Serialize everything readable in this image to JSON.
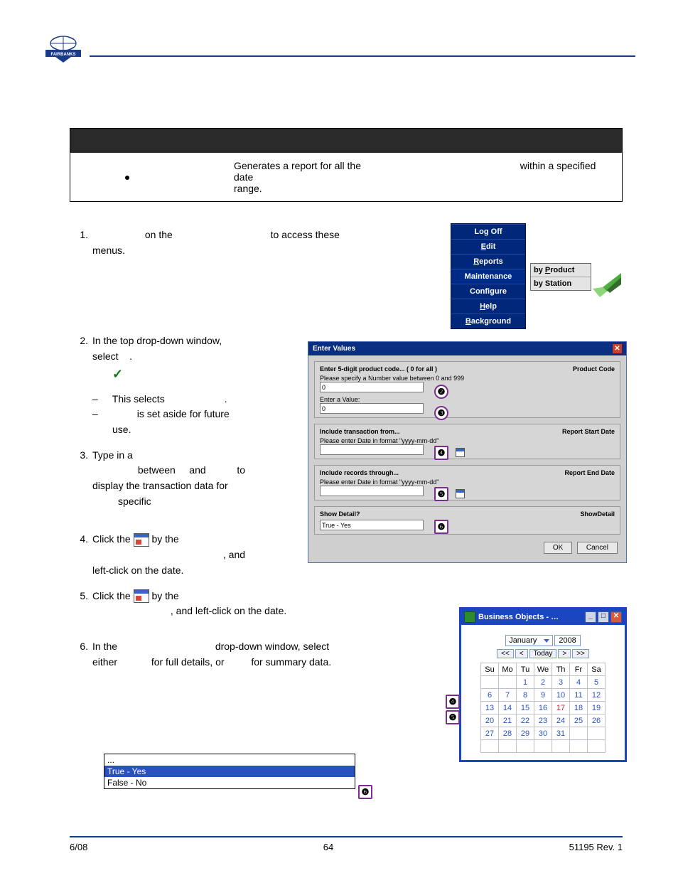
{
  "header": {
    "logo_top": "F A I R B A N K S"
  },
  "desc": {
    "pre": "Generates a report for all the",
    "post": "within a specified date",
    "range": "range."
  },
  "steps": {
    "s1a": "on the",
    "s1b": "to access these",
    "s1c": "menus.",
    "s2a": "In the top drop-down window,",
    "s2b": "select",
    "s2dot": ".",
    "s2c": "This selects",
    "s2d": "is set aside for future",
    "s2e": "use.",
    "s3a": "Type in a",
    "s3b": "between",
    "s3c": "and",
    "s3d": "to",
    "s3e": "display the transaction data for",
    "s3f": "specific",
    "s4a": "Click the",
    "s4b": "by the",
    "s4c": ", and",
    "s4d": "left-click on the date.",
    "s5a": "Click the",
    "s5b": "by the",
    "s5c": ", and left-click on the date.",
    "s6a": "In the",
    "s6b": "drop-down window, select",
    "s6c": "either",
    "s6d": "for full details, or",
    "s6e": "for summary data."
  },
  "menu": {
    "items": [
      "Log Off",
      "Edit",
      "Reports",
      "Maintenance",
      "Configure",
      "Help",
      "Background"
    ],
    "sub": [
      "by Product",
      "by Station"
    ]
  },
  "dialog": {
    "title": "Enter Values",
    "g1": {
      "head": "Enter 5-digit product code... ( 0 for all )",
      "right": "Product Code",
      "l1": "Please specify a Number value between 0 and 999",
      "v1": "0",
      "l2": "Enter a Value:",
      "v2": "0"
    },
    "g2": {
      "head": "Include transaction from...",
      "right": "Report Start Date",
      "l1": "Please enter Date in format \"yyyy-mm-dd\""
    },
    "g3": {
      "head": "Include records through...",
      "right": "Report End Date",
      "l1": "Please enter Date in format \"yyyy-mm-dd\""
    },
    "g4": {
      "head": "Show Detail?",
      "right": "ShowDetail",
      "v": "True - Yes"
    },
    "ok": "OK",
    "cancel": "Cancel"
  },
  "calpop": {
    "title": "Business Objects - …",
    "month": "January",
    "year": "2008",
    "nav": [
      "<<",
      "<",
      "Today",
      ">",
      ">>"
    ],
    "dow": [
      "Su",
      "Mo",
      "Tu",
      "We",
      "Th",
      "Fr",
      "Sa"
    ],
    "rows": [
      [
        "",
        "",
        "1",
        "2",
        "3",
        "4",
        "5"
      ],
      [
        "6",
        "7",
        "8",
        "9",
        "10",
        "11",
        "12"
      ],
      [
        "13",
        "14",
        "15",
        "16",
        "17",
        "18",
        "19"
      ],
      [
        "20",
        "21",
        "22",
        "23",
        "24",
        "25",
        "26"
      ],
      [
        "27",
        "28",
        "29",
        "30",
        "31",
        "",
        ""
      ],
      [
        "",
        "",
        "",
        "",
        "",
        "",
        ""
      ]
    ]
  },
  "ddlist": {
    "r0": "...",
    "r1": "True  - Yes",
    "r2": "False - No"
  },
  "badges": {
    "b2": "❷",
    "b3": "❸",
    "b4": "❹",
    "b5": "❺",
    "b6": "❻"
  },
  "footer": {
    "left": "6/08",
    "mid": "64",
    "right": "51195    Rev. 1"
  }
}
